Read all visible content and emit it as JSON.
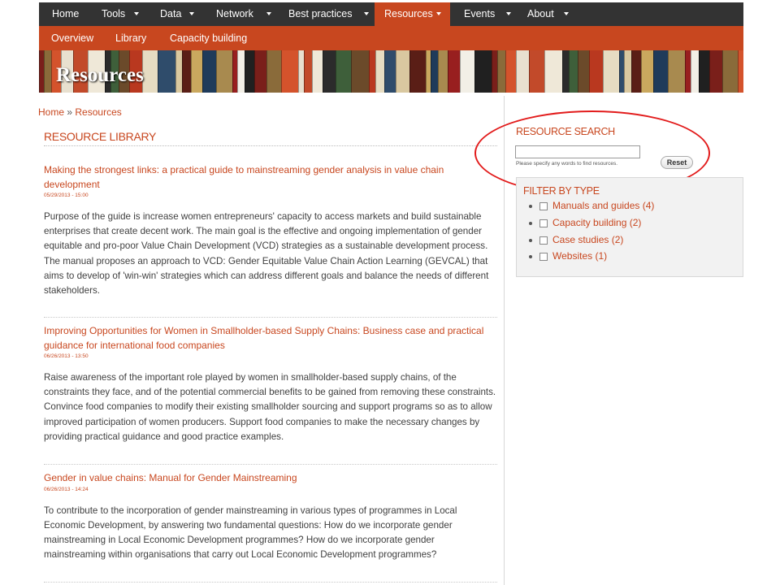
{
  "nav": {
    "items": [
      {
        "label": "Home",
        "dropdown": false
      },
      {
        "label": "Tools",
        "dropdown": true
      },
      {
        "label": "Data",
        "dropdown": true
      },
      {
        "label": "Network",
        "dropdown": true
      },
      {
        "label": "Best practices",
        "dropdown": true
      },
      {
        "label": "Resources",
        "dropdown": true,
        "active": true
      },
      {
        "label": "Events",
        "dropdown": true
      },
      {
        "label": "About",
        "dropdown": true
      }
    ]
  },
  "subnav": {
    "items": [
      "Overview",
      "Library",
      "Capacity building"
    ]
  },
  "banner": {
    "title": "Resources"
  },
  "breadcrumb": {
    "home": "Home",
    "separator": "»",
    "current": "Resources"
  },
  "main": {
    "heading": "RESOURCE LIBRARY",
    "articles": [
      {
        "title": "Making the strongest links: a practical guide to mainstreaming gender analysis in value chain development",
        "date": "05/29/2013 - 15:00",
        "body": "Purpose of the guide is increase women entrepreneurs' capacity to access markets and build sustainable enterprises that create decent work. The main goal is the effective and ongoing implementation of gender equitable and pro-poor Value Chain Development (VCD) strategies as a sustainable development process. The manual proposes an approach to VCD: Gender Equitable Value Chain Action Learning (GEVCAL) that aims to develop of 'win-win' strategies which can address different goals and balance the needs of different stakeholders."
      },
      {
        "title": "Improving Opportunities for Women in Smallholder-based Supply Chains: Business case and practical guidance for international food companies",
        "date": "06/26/2013 - 13:50",
        "body": "Raise awareness of the important role played by women in smallholder-based supply chains, of the constraints they face, and of the potential commercial benefits to be gained from removing these constraints. Convince food companies to modify their existing smallholder sourcing and support programs so as to allow improved participation of women producers. Support food companies to make the necessary changes by providing practical guidance and good practice examples."
      },
      {
        "title": "Gender in value chains: Manual for Gender Mainstreaming",
        "date": "06/26/2013 - 14:24",
        "body": "To contribute to the incorporation of gender mainstreaming in various types of programmes in Local Economic Development, by answering two fundamental questions: How do we incorporate gender mainstreaming in Local Economic Development programmes?  How do we incorporate gender mainstreaming within organisations that carry out Local Economic Development programmes?"
      }
    ]
  },
  "sidebar": {
    "search": {
      "heading": "RESOURCE SEARCH",
      "value": "",
      "hint": "Please specify any words to find resources.",
      "reset_label": "Reset"
    },
    "filter": {
      "heading": "FILTER BY TYPE",
      "items": [
        {
          "label": "Manuals and guides (4)",
          "checked": false
        },
        {
          "label": "Capacity building (2)",
          "checked": false
        },
        {
          "label": "Case studies (2)",
          "checked": false
        },
        {
          "label": "Websites (1)",
          "checked": false
        }
      ]
    }
  },
  "colors": {
    "accent": "#c8471f",
    "nav_bg": "#333333",
    "annotation": "#e21b1b"
  }
}
